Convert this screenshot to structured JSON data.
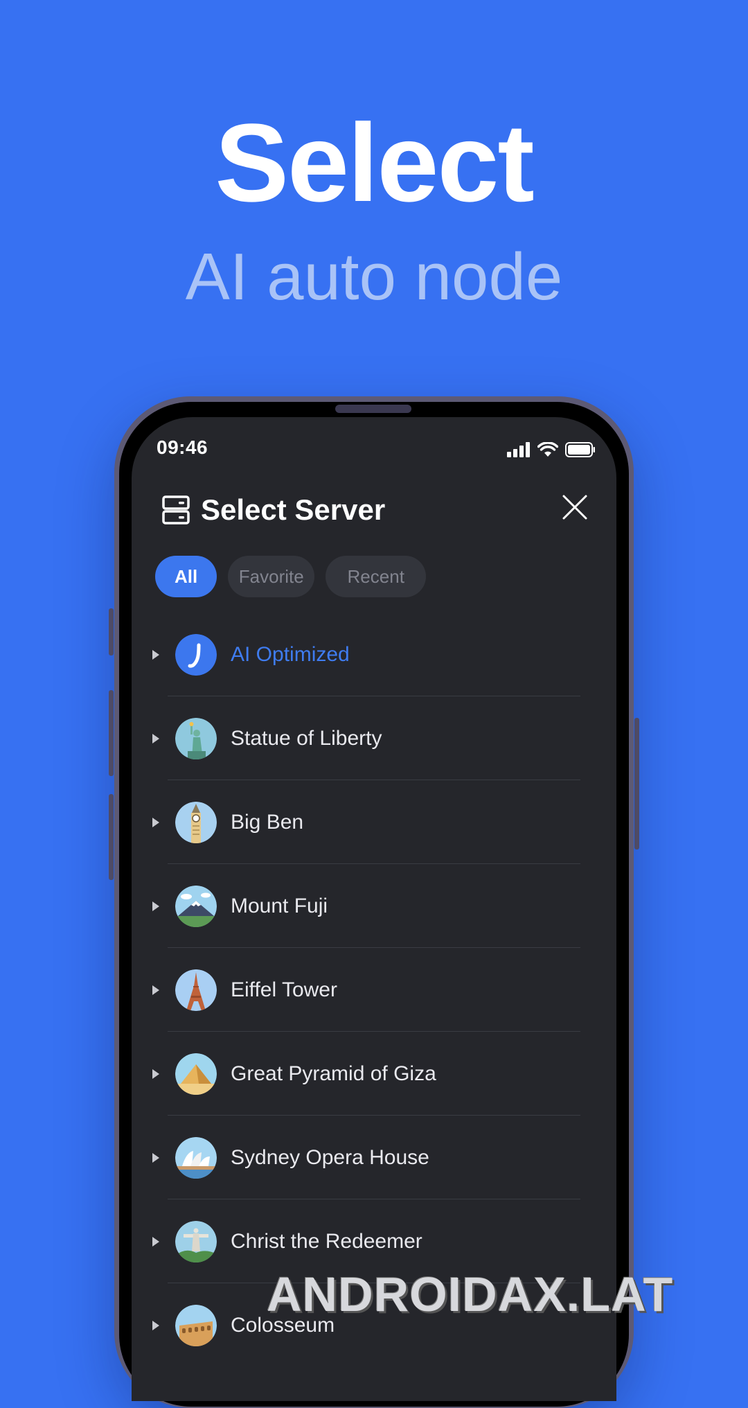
{
  "hero": {
    "headline": "Select",
    "subline": "AI auto node"
  },
  "status_bar": {
    "time": "09:46",
    "icons": [
      "signal-icon",
      "wifi-icon",
      "battery-icon"
    ]
  },
  "sheet": {
    "title": "Select Server",
    "icon": "server-icon",
    "close_icon": "close-icon"
  },
  "tabs": [
    {
      "label": "All",
      "active": true
    },
    {
      "label": "Favorite",
      "active": false
    },
    {
      "label": "Recent",
      "active": false
    }
  ],
  "servers": [
    {
      "label": "AI Optimized",
      "icon": "ai-logo-icon",
      "highlighted": true
    },
    {
      "label": "Statue of Liberty",
      "icon": "statue-of-liberty-icon"
    },
    {
      "label": "Big Ben",
      "icon": "big-ben-icon"
    },
    {
      "label": "Mount Fuji",
      "icon": "mount-fuji-icon"
    },
    {
      "label": "Eiffel Tower",
      "icon": "eiffel-tower-icon"
    },
    {
      "label": "Great Pyramid of Giza",
      "icon": "pyramid-icon"
    },
    {
      "label": "Sydney Opera House",
      "icon": "opera-house-icon"
    },
    {
      "label": "Christ the Redeemer",
      "icon": "christ-redeemer-icon"
    },
    {
      "label": "Colosseum",
      "icon": "colosseum-icon"
    }
  ],
  "watermark": "ANDROIDAX.LAT",
  "colors": {
    "background": "#3771f2",
    "accent": "#3c77ee",
    "screen": "#25262b"
  }
}
